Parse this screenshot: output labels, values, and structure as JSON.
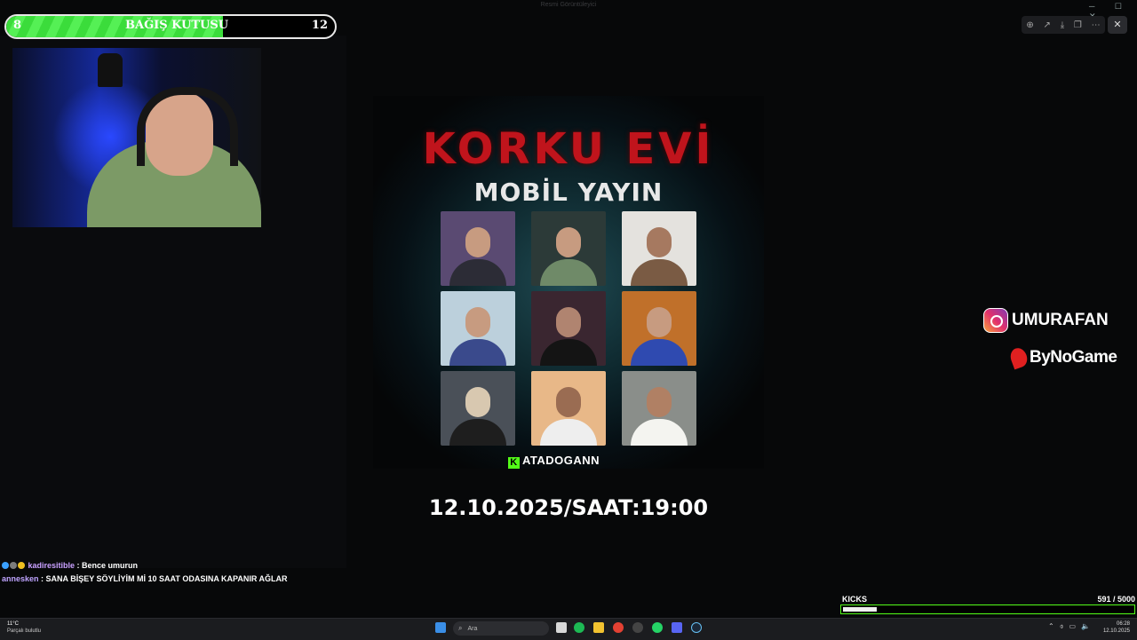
{
  "window": {
    "title": "Resmi Görüntüleyici",
    "controls": "─ ☐ ✕"
  },
  "viewer_toolbar": {
    "icons": [
      "zoom-in-icon",
      "share-icon",
      "download-icon",
      "copy-icon",
      "more-icon"
    ],
    "close": "✕"
  },
  "donation": {
    "label": "BAĞIŞ KUTUSU",
    "current": "8",
    "goal": "12",
    "progress": 0.66
  },
  "poster": {
    "title": "KORKU EVİ",
    "subtitle": "MOBİL YAYIN",
    "brand": "ATADOGANN",
    "brand_icon": "K",
    "datetime": "12.10.2025/SAAT:19:00"
  },
  "socials": {
    "instagram": "UMURAFAN",
    "sponsor": "ByNoGame"
  },
  "chat": [
    {
      "user": "kadiresitible",
      "message": " : Bence umurun"
    },
    {
      "user": "annesken",
      "message": " : SANA BİŞEY SÖYLİYİM Mİ 10 SAAT ODASINA KAPANIR AĞLAR"
    }
  ],
  "kicks": {
    "label": "KICKS",
    "count": "591  / 5000",
    "progress": 0.118
  },
  "taskbar": {
    "weather_temp": "11°C",
    "weather_desc": "Parçalı bulutlu",
    "search_placeholder": "Ara",
    "time": "06:28",
    "date": "12.10.2025"
  },
  "colors": {
    "accent_green": "#53fc18",
    "title_red": "#c0141c",
    "donation_green": "#3bdc3b"
  }
}
